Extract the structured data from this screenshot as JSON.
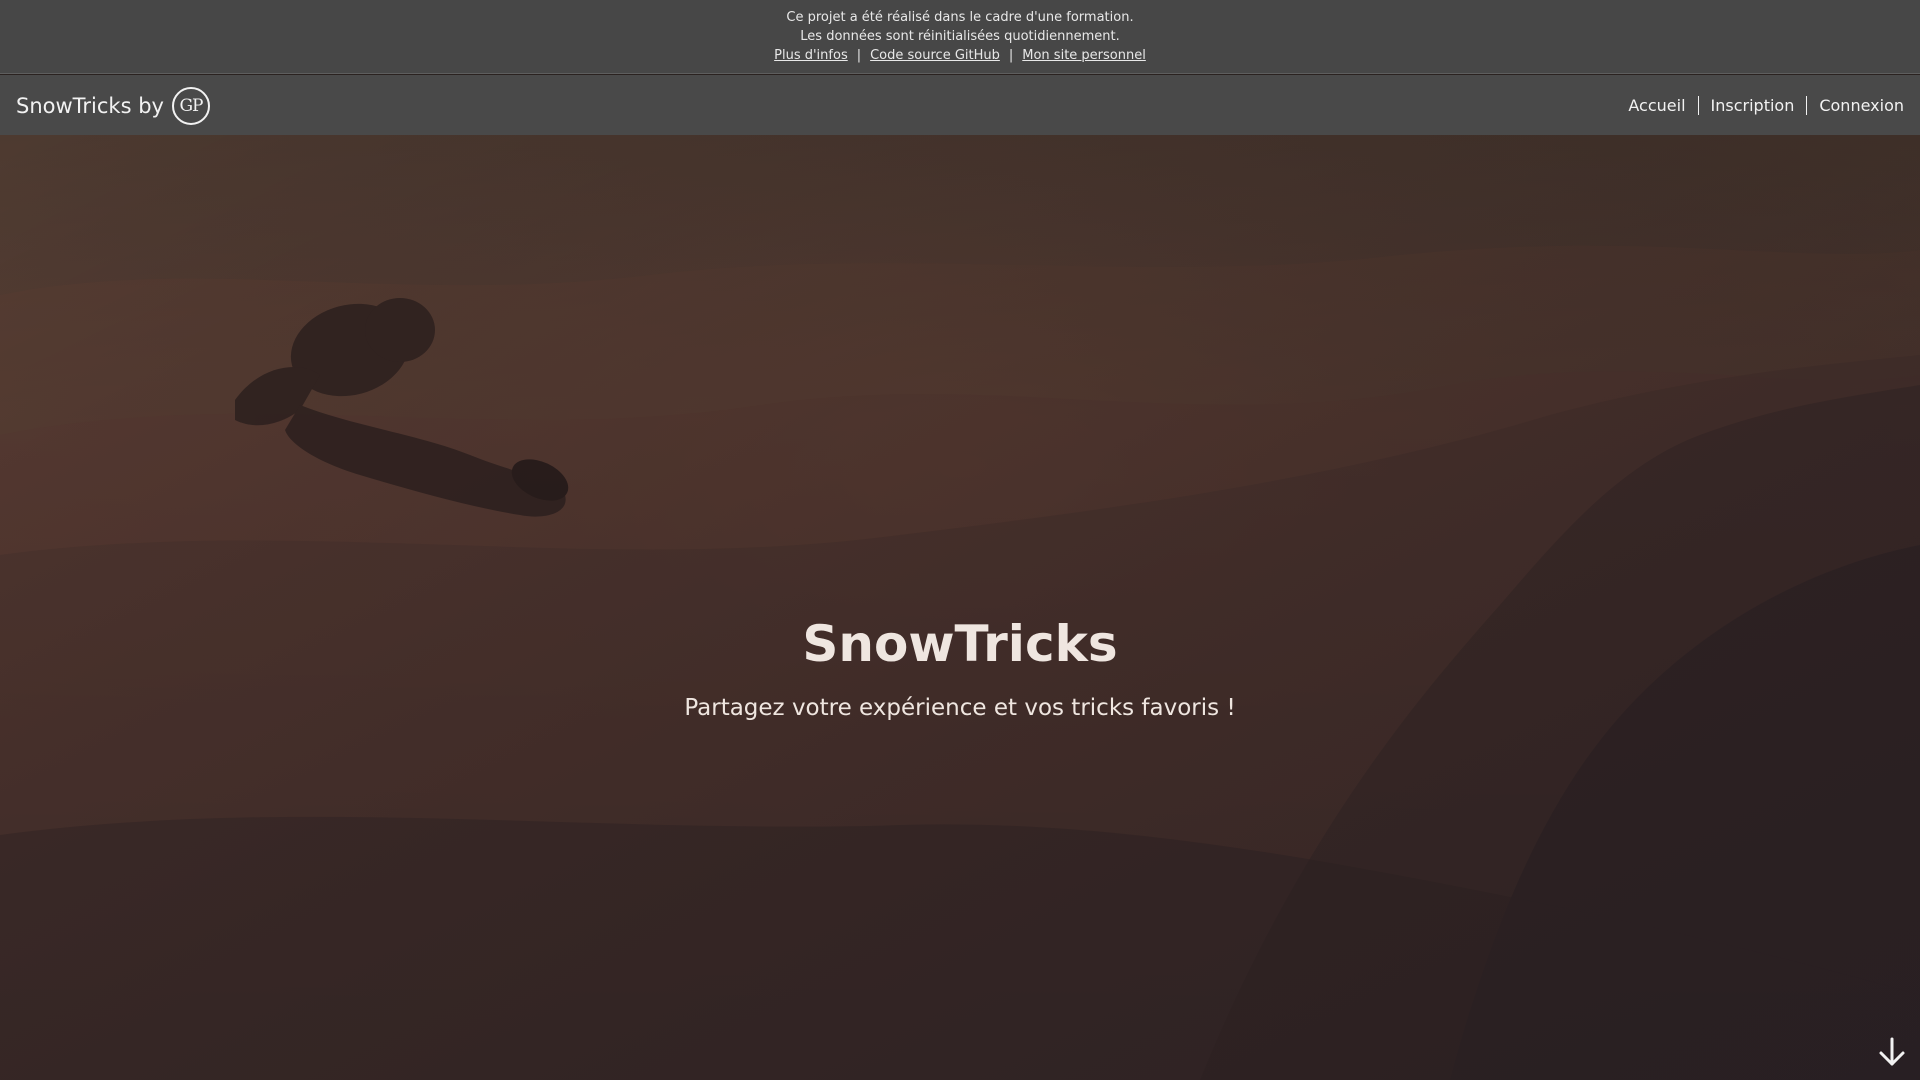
{
  "notice": {
    "line1": "Ce projet a été réalisé dans le cadre d'une formation.",
    "line2": "Les données sont réinitialisées quotidiennement.",
    "links": [
      {
        "label": "Plus d'infos"
      },
      {
        "label": "Code source GitHub"
      },
      {
        "label": "Mon site personnel"
      }
    ],
    "separator": "|"
  },
  "navbar": {
    "brand_text": "SnowTricks by",
    "logo_text": "GP",
    "links": [
      {
        "label": "Accueil"
      },
      {
        "label": "Inscription"
      },
      {
        "label": "Connexion"
      }
    ]
  },
  "hero": {
    "title": "SnowTricks",
    "subtitle": "Partagez votre expérience et vos tricks favoris !",
    "scroll_icon": "arrow-down-icon"
  },
  "colors": {
    "banner_bg": "#474747",
    "navbar_bg": "#494949",
    "hero_text": "#efe6e0"
  }
}
